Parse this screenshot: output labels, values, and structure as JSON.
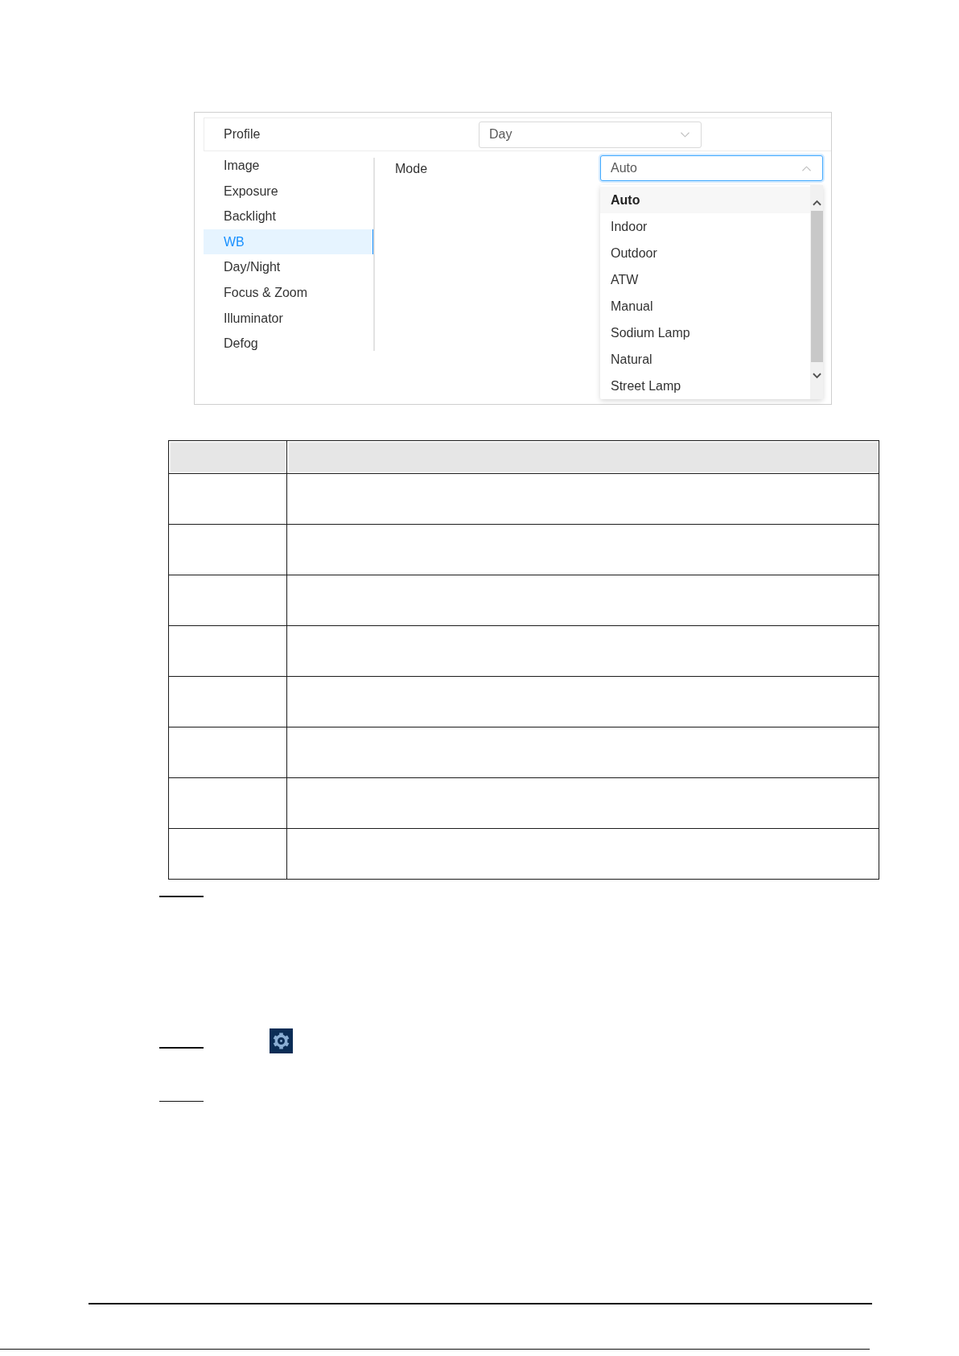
{
  "profile": {
    "label": "Profile",
    "select": {
      "value": "Day",
      "expanded": false
    }
  },
  "sidebar": {
    "items": [
      {
        "label": "Image",
        "selected": false
      },
      {
        "label": "Exposure",
        "selected": false
      },
      {
        "label": "Backlight",
        "selected": false
      },
      {
        "label": "WB",
        "selected": true
      },
      {
        "label": "Day/Night",
        "selected": false
      },
      {
        "label": "Focus & Zoom",
        "selected": false
      },
      {
        "label": "Illuminator",
        "selected": false
      },
      {
        "label": "Defog",
        "selected": false
      }
    ]
  },
  "mode": {
    "label": "Mode",
    "select": {
      "value": "Auto",
      "expanded": true,
      "options": [
        {
          "label": "Auto",
          "selected": true
        },
        {
          "label": "Indoor",
          "selected": false
        },
        {
          "label": "Outdoor",
          "selected": false
        },
        {
          "label": "ATW",
          "selected": false
        },
        {
          "label": "Manual",
          "selected": false
        },
        {
          "label": "Sodium Lamp",
          "selected": false
        },
        {
          "label": "Natural",
          "selected": false
        },
        {
          "label": "Street Lamp",
          "selected": false
        }
      ]
    }
  }
}
